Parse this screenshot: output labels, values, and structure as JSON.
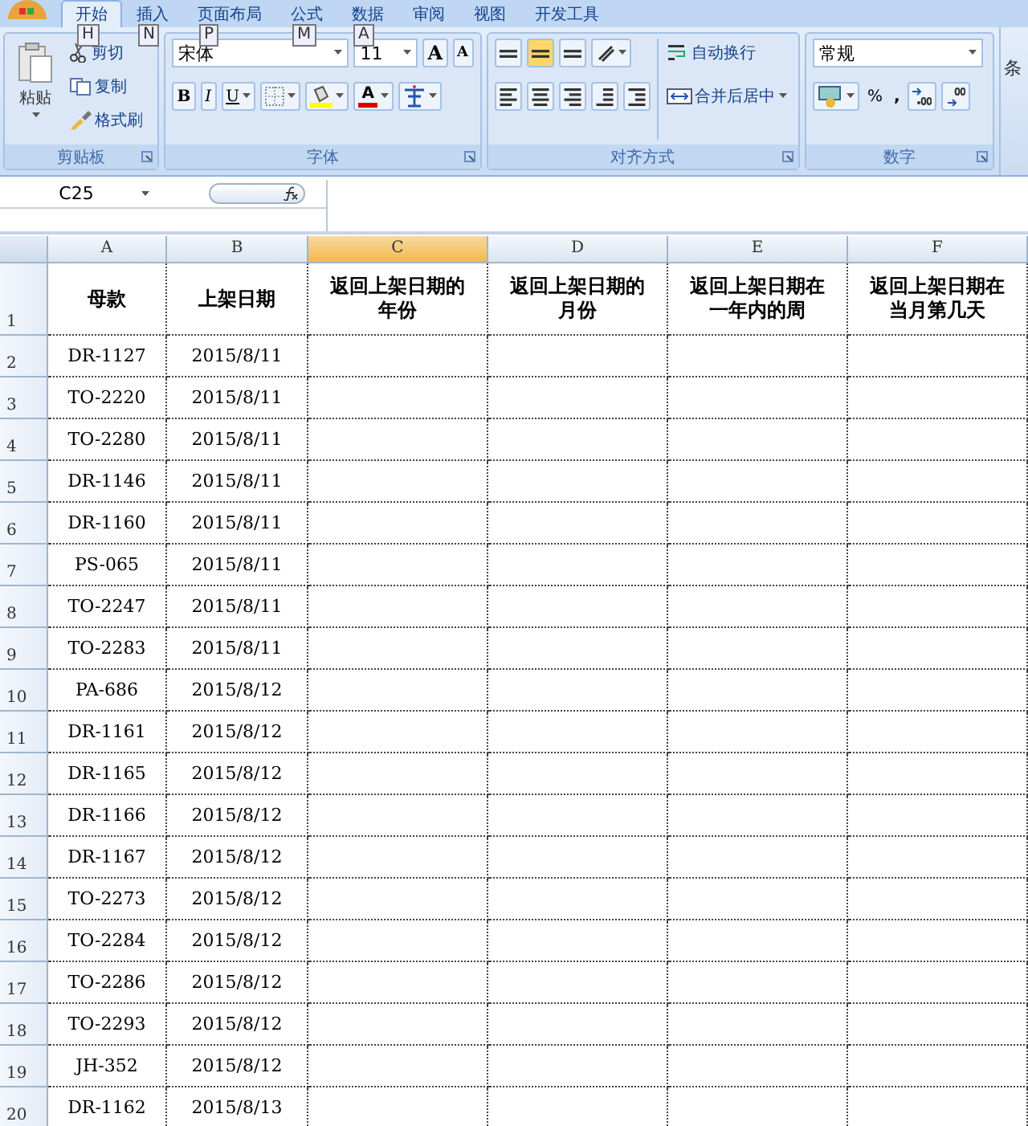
{
  "tabs": [
    {
      "label": "开始",
      "selected": true,
      "keytip": "H"
    },
    {
      "label": "插入",
      "selected": false,
      "keytip": "N"
    },
    {
      "label": "页面布局",
      "selected": false,
      "keytip": "P"
    },
    {
      "label": "公式",
      "selected": false,
      "keytip": "M"
    },
    {
      "label": "数据",
      "selected": false,
      "keytip": "A"
    },
    {
      "label": "审阅",
      "selected": false
    },
    {
      "label": "视图",
      "selected": false
    },
    {
      "label": "开发工具",
      "selected": false
    }
  ],
  "ribbon": {
    "clipboard": {
      "title": "剪贴板",
      "paste": "粘贴",
      "items": [
        "剪切",
        "复制",
        "格式刷"
      ]
    },
    "font": {
      "title": "字体",
      "font_name": "宋体",
      "font_size": "11",
      "grow": "A",
      "shrink": "A",
      "styles": [
        "B",
        "I",
        "U"
      ],
      "font_color": "A"
    },
    "alignment": {
      "title": "对齐方式",
      "wrap_text": "自动换行",
      "merge_center": "合并后居中"
    },
    "number": {
      "title": "数字",
      "format": "常规",
      "percent": "%",
      "comma": ","
    },
    "next_group_partial": "条"
  },
  "formula_bar": {
    "name_box": "C25"
  },
  "sheet": {
    "columns": [
      {
        "label": "A",
        "selected": false
      },
      {
        "label": "B",
        "selected": false
      },
      {
        "label": "C",
        "selected": true
      },
      {
        "label": "D",
        "selected": false
      },
      {
        "label": "E",
        "selected": false
      },
      {
        "label": "F",
        "selected": false
      }
    ],
    "rows": [
      {
        "number": "1",
        "cells": [
          "母款",
          "上架日期",
          "返回上架日期的年份",
          "返回上架日期的月份",
          "返回上架日期在一年内的周",
          "返回上架日期在当月第几天"
        ]
      },
      {
        "number": "2",
        "cells": [
          "DR-1127",
          "2015/8/11"
        ]
      },
      {
        "number": "3",
        "cells": [
          "TO-2220",
          "2015/8/11"
        ]
      },
      {
        "number": "4",
        "cells": [
          "TO-2280",
          "2015/8/11"
        ]
      },
      {
        "number": "5",
        "cells": [
          "DR-1146",
          "2015/8/11"
        ]
      },
      {
        "number": "6",
        "cells": [
          "DR-1160",
          "2015/8/11"
        ]
      },
      {
        "number": "7",
        "cells": [
          "PS-065",
          "2015/8/11"
        ]
      },
      {
        "number": "8",
        "cells": [
          "TO-2247",
          "2015/8/11"
        ]
      },
      {
        "number": "9",
        "cells": [
          "TO-2283",
          "2015/8/11"
        ]
      },
      {
        "number": "10",
        "cells": [
          "PA-686",
          "2015/8/12"
        ]
      },
      {
        "number": "11",
        "cells": [
          "DR-1161",
          "2015/8/12"
        ]
      },
      {
        "number": "12",
        "cells": [
          "DR-1165",
          "2015/8/12"
        ]
      },
      {
        "number": "13",
        "cells": [
          "DR-1166",
          "2015/8/12"
        ]
      },
      {
        "number": "14",
        "cells": [
          "DR-1167",
          "2015/8/12"
        ]
      },
      {
        "number": "15",
        "cells": [
          "TO-2273",
          "2015/8/12"
        ]
      },
      {
        "number": "16",
        "cells": [
          "TO-2284",
          "2015/8/12"
        ]
      },
      {
        "number": "17",
        "cells": [
          "TO-2286",
          "2015/8/12"
        ]
      },
      {
        "number": "18",
        "cells": [
          "TO-2293",
          "2015/8/12"
        ]
      },
      {
        "number": "19",
        "cells": [
          "JH-352",
          "2015/8/12"
        ]
      },
      {
        "number": "20",
        "cells": [
          "DR-1162",
          "2015/8/13"
        ]
      }
    ]
  }
}
